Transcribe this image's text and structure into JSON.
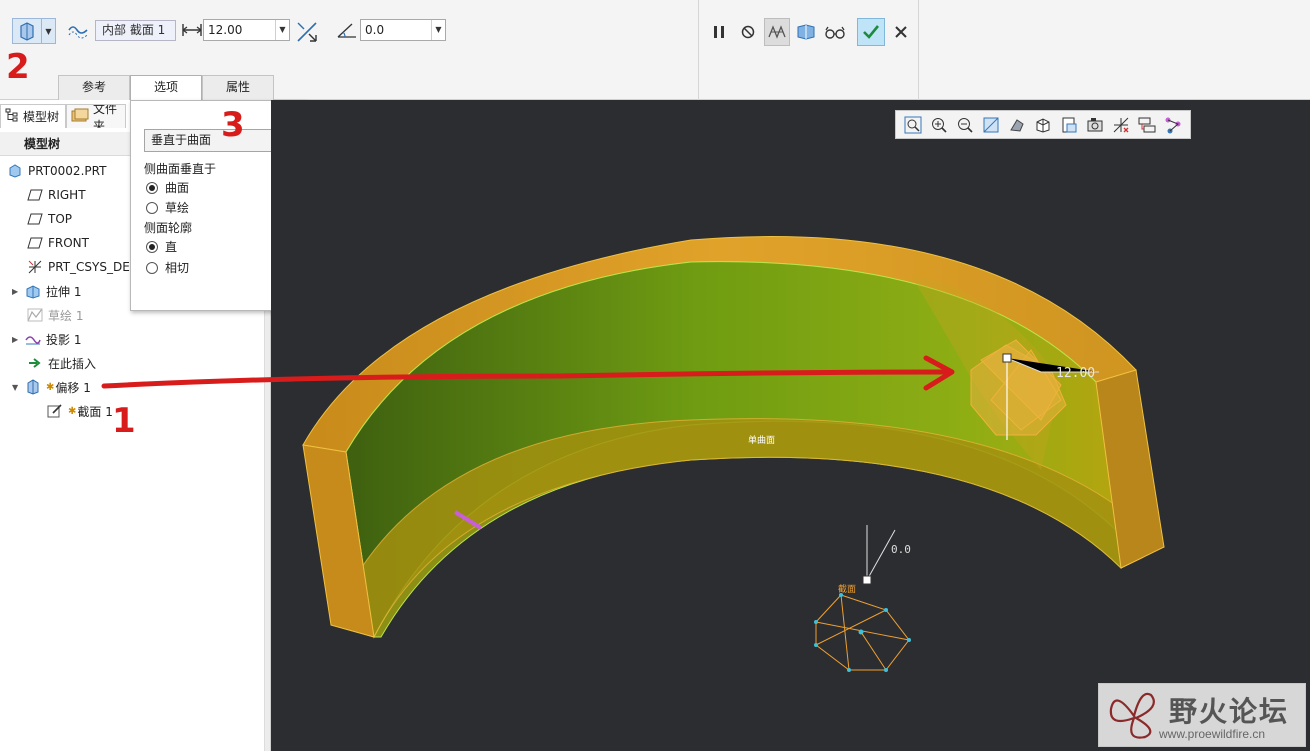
{
  "ribbon": {
    "section_label": "内部 截面 1",
    "distance_value": "12.00",
    "angle_value": "0.0",
    "tabs": [
      {
        "label": "参考"
      },
      {
        "label": "选项"
      },
      {
        "label": "属性"
      }
    ]
  },
  "model_tree": {
    "tabs": [
      {
        "label": "模型树"
      },
      {
        "label": "文件夹"
      }
    ],
    "header": "模型树",
    "items": [
      {
        "label": "PRT0002.PRT",
        "icon": "part-icon"
      },
      {
        "label": "RIGHT",
        "icon": "datum-plane-icon"
      },
      {
        "label": "TOP",
        "icon": "datum-plane-icon"
      },
      {
        "label": "FRONT",
        "icon": "datum-plane-icon"
      },
      {
        "label": "PRT_CSYS_DEF",
        "icon": "csys-icon"
      },
      {
        "label": "拉伸 1",
        "icon": "extrude-icon"
      },
      {
        "label": "草绘 1",
        "icon": "sketch-icon"
      },
      {
        "label": "投影 1",
        "icon": "projection-icon"
      },
      {
        "label": "在此插入",
        "icon": "insert-arrow-icon"
      },
      {
        "label": "偏移 1",
        "icon": "offset-icon"
      },
      {
        "label": "截面 1",
        "icon": "section-icon"
      }
    ]
  },
  "options_panel": {
    "combo_value": "垂直于曲面",
    "group1_label": "侧曲面垂直于",
    "group1_options": [
      "曲面",
      "草绘"
    ],
    "group2_label": "侧面轮廓",
    "group2_options": [
      "直",
      "相切"
    ]
  },
  "viewport": {
    "dim_value": "12.00",
    "angle_dim": "0.0",
    "surface_label": "单曲面",
    "section_label": "截面"
  },
  "watermark": {
    "title": "野火论坛",
    "url": "www.proewildfire.cn"
  },
  "annotations": [
    "2",
    "3",
    "1"
  ],
  "colors": {
    "viewport_bg": "#2c2d31",
    "ring_orange": "#d79a1e",
    "inner_green": "#6a9a10",
    "annotation_red": "#d81c1c"
  }
}
